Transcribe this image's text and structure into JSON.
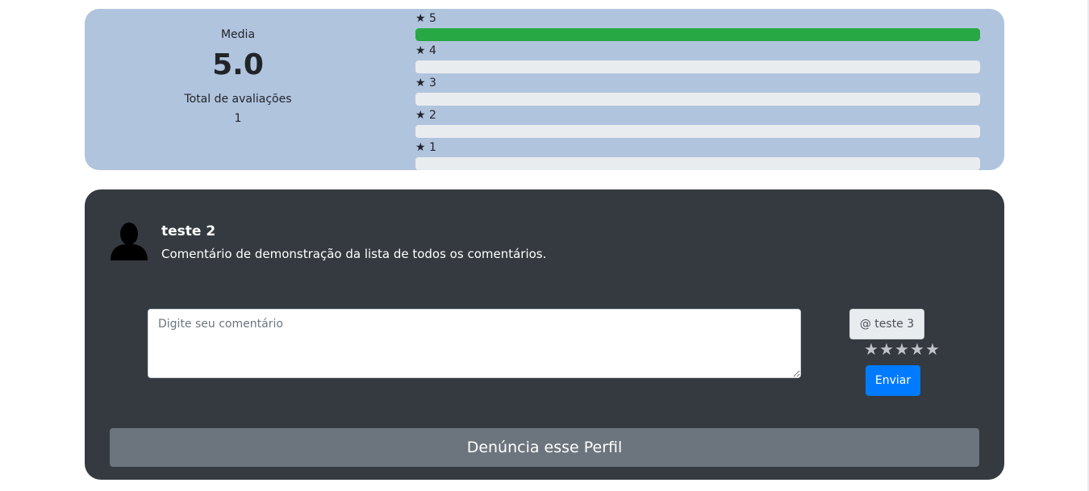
{
  "rating_summary": {
    "average_label": "Media",
    "average_value": "5.0",
    "total_label": "Total de avaliações",
    "total_value": "1"
  },
  "rating_bars": [
    {
      "label": "★ 5",
      "fraction": 1.0
    },
    {
      "label": "★ 4",
      "fraction": 0.0
    },
    {
      "label": "★ 3",
      "fraction": 0.0
    },
    {
      "label": "★ 2",
      "fraction": 0.0
    },
    {
      "label": "★ 1",
      "fraction": 0.0
    }
  ],
  "comment": {
    "author": "teste 2",
    "text": "Comentário de demonstração da lista de todos os comentários."
  },
  "reply_form": {
    "placeholder": "Digite seu comentário",
    "value": "",
    "mention": "@ teste 3",
    "stars": [
      "★",
      "★",
      "★",
      "★",
      "★"
    ],
    "send_label": "Enviar"
  },
  "report": {
    "label": "Denúncia esse Perfil"
  },
  "colors": {
    "rating_card_bg": "#b0c4de",
    "comment_card_bg": "#343a40",
    "bar_fill": "#28a745",
    "send_button": "#007bff",
    "report_button": "#6c757d"
  }
}
